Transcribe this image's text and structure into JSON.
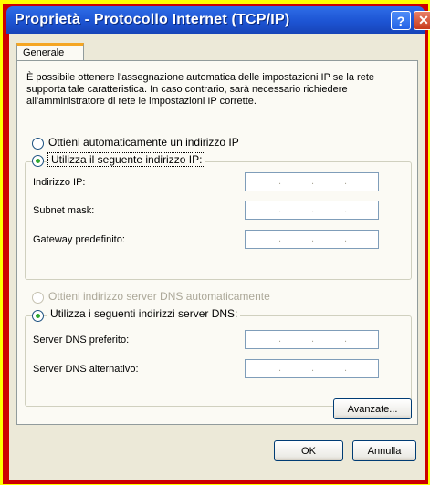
{
  "window": {
    "title": "Proprietà - Protocollo Internet (TCP/IP)",
    "help_glyph": "?",
    "close_glyph": "✕"
  },
  "tabs": [
    {
      "label": "Generale",
      "active": true
    }
  ],
  "description": "È possibile ottenere l'assegnazione automatica delle impostazioni IP se la rete supporta tale caratteristica. In caso contrario, sarà necessario richiedere all'amministratore di rete le impostazioni IP corrette.",
  "ip_section": {
    "auto_option": {
      "label": "Ottieni automaticamente un indirizzo IP",
      "selected": false
    },
    "manual_option": {
      "label": "Utilizza il seguente indirizzo IP:",
      "selected": true
    },
    "fields": [
      {
        "label": "Indirizzo IP:",
        "value": ". . ."
      },
      {
        "label": "Subnet mask:",
        "value": ". . ."
      },
      {
        "label": "Gateway predefinito:",
        "value": ". . ."
      }
    ]
  },
  "dns_section": {
    "auto_option": {
      "label": "Ottieni indirizzo server DNS automaticamente",
      "selected": false,
      "enabled": false
    },
    "manual_option": {
      "label": "Utilizza i seguenti indirizzi server DNS:",
      "selected": true
    },
    "fields": [
      {
        "label": "Server DNS preferito:",
        "value": ". . ."
      },
      {
        "label": "Server DNS alternativo:",
        "value": ". . ."
      }
    ]
  },
  "buttons": {
    "advanced": "Avanzate...",
    "ok": "OK",
    "cancel": "Annulla"
  },
  "colors": {
    "outer_border": "#ffff00",
    "inner_border": "#cc0000",
    "titlebar": "#1d54d3",
    "dialog_bg": "#ece9d8",
    "radio_selected": "#2fa82f"
  }
}
